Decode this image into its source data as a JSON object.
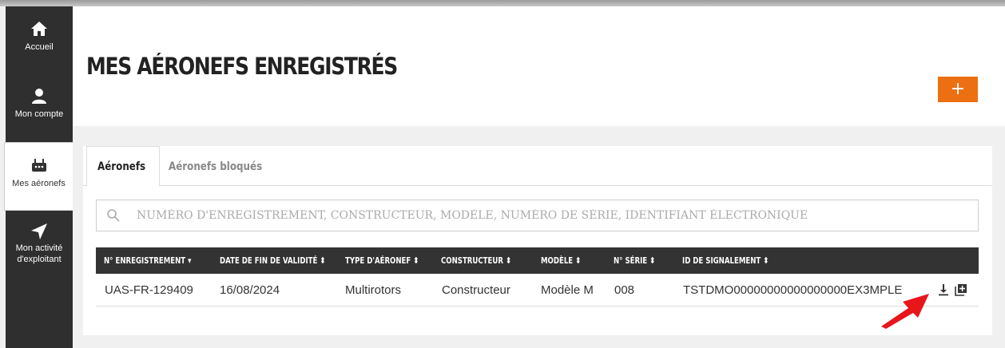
{
  "sidebar": {
    "items": [
      {
        "label": "Accueil",
        "icon": "home-icon"
      },
      {
        "label": "Mon compte",
        "icon": "user-icon"
      },
      {
        "label": "Mes aéronefs",
        "icon": "drone-icon"
      },
      {
        "label_line1": "Mon activité",
        "label_line2": "d'exploitant",
        "icon": "location-arrow-icon"
      }
    ]
  },
  "header": {
    "title": "MES AÉRONEFS ENREGISTRÉS",
    "add_label": "+"
  },
  "tabs": [
    {
      "label": "Aéronefs",
      "active": true
    },
    {
      "label": "Aéronefs bloqués",
      "active": false
    }
  ],
  "search": {
    "placeholder": "NUMÉRO D'ENREGISTREMENT, CONSTRUCTEUR, MODÈLE, NUMÉRO DE SÉRIE, IDENTIFIANT ÉLECTRONIQUE"
  },
  "table": {
    "columns": [
      {
        "label": "N° ENREGISTREMENT",
        "sort": "▾"
      },
      {
        "label": "DATE DE FIN DE VALIDITÉ",
        "sort": "⬍"
      },
      {
        "label": "TYPE D'AÉRONEF",
        "sort": "⬍"
      },
      {
        "label": "CONSTRUCTEUR",
        "sort": "⬍"
      },
      {
        "label": "MODÈLE",
        "sort": "⬍"
      },
      {
        "label": "N° SÉRIE",
        "sort": "⬍"
      },
      {
        "label": "ID DE SIGNALEMENT",
        "sort": "⬍"
      }
    ],
    "rows": [
      {
        "registration": "UAS-FR-129409",
        "expiry": "16/08/2024",
        "type": "Multirotors",
        "manufacturer": "Constructeur",
        "model": "Modèle M",
        "serial": "008",
        "signal_id": "TSTDMO00000000000000000EX3MPLE"
      }
    ]
  },
  "colors": {
    "accent": "#ec7012",
    "sidebar_bg": "#2f2f2f",
    "table_header_bg": "#333333",
    "annotation_arrow": "#e8151b"
  }
}
